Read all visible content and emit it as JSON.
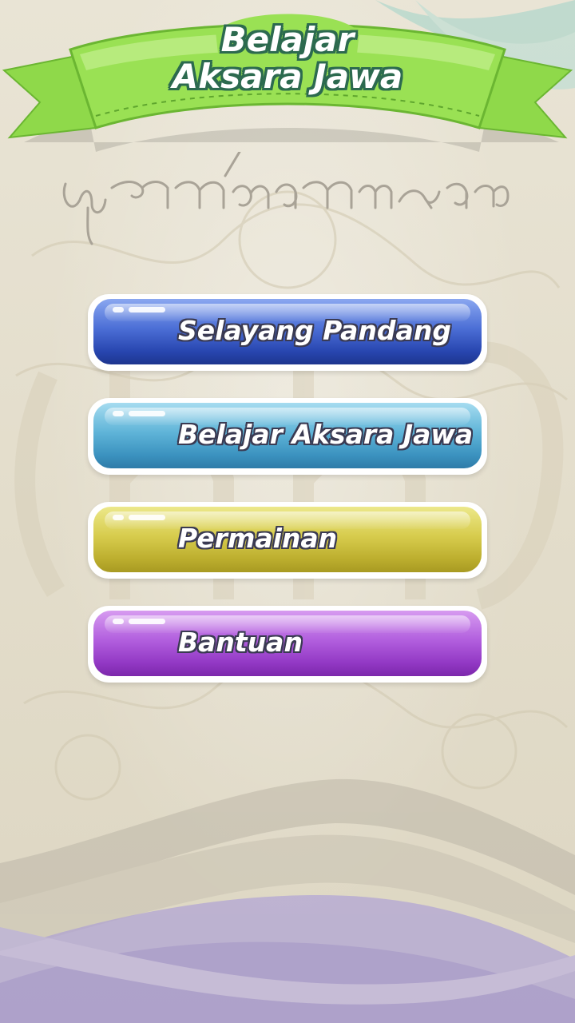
{
  "app": {
    "title_line1": "Belajar",
    "title_line2": "Aksara Jawa",
    "javanese_script_glyph": "javanese-script-title"
  },
  "menu": {
    "buttons": [
      {
        "label": "Selayang Pandang",
        "color": "#3a5cc9"
      },
      {
        "label": "Belajar Aksara Jawa",
        "color": "#4aa3cf"
      },
      {
        "label": "Permainan",
        "color": "#c9bd3a"
      },
      {
        "label": "Bantuan",
        "color": "#a24bd1"
      }
    ]
  },
  "colors": {
    "banner_green": "#8fd94a",
    "banner_dark_green": "#5fa62e",
    "background": "#e6e0cf",
    "swoosh_purple": "#9c8ad8"
  }
}
